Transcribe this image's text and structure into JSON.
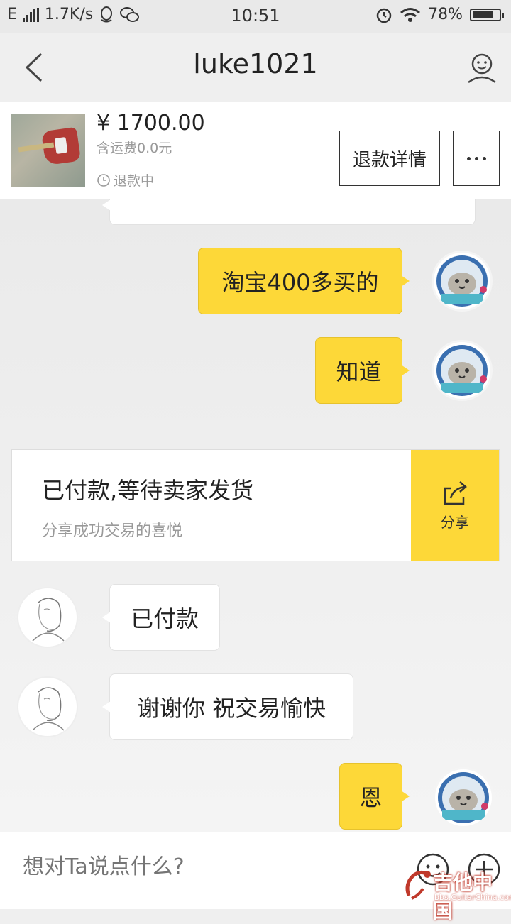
{
  "statusbar": {
    "network": "E",
    "speed": "1.7K/s",
    "time": "10:51",
    "battery": "78%",
    "battery_level": 0.78
  },
  "header": {
    "title": "luke1021"
  },
  "order": {
    "price": "¥ 1700.00",
    "shipping": "含运费0.0元",
    "status": "退款中",
    "refund_button": "退款详情"
  },
  "messages": [
    {
      "from": "me",
      "text": "淘宝400多买的"
    },
    {
      "from": "me",
      "text": "知道"
    },
    {
      "from": "them",
      "text": "已付款"
    },
    {
      "from": "them",
      "text": "谢谢你  祝交易愉快"
    },
    {
      "from": "me",
      "text": "恩"
    }
  ],
  "system_card": {
    "title": "已付款,等待卖家发货",
    "subtitle": "分享成功交易的喜悦",
    "share_label": "分享"
  },
  "input": {
    "placeholder": "想对Ta说点什么?"
  },
  "watermark": {
    "text": "吉他中国",
    "sub": "bbs.GuitarChina.com"
  },
  "colors": {
    "accent": "#fdd838",
    "background": "#efefef"
  }
}
